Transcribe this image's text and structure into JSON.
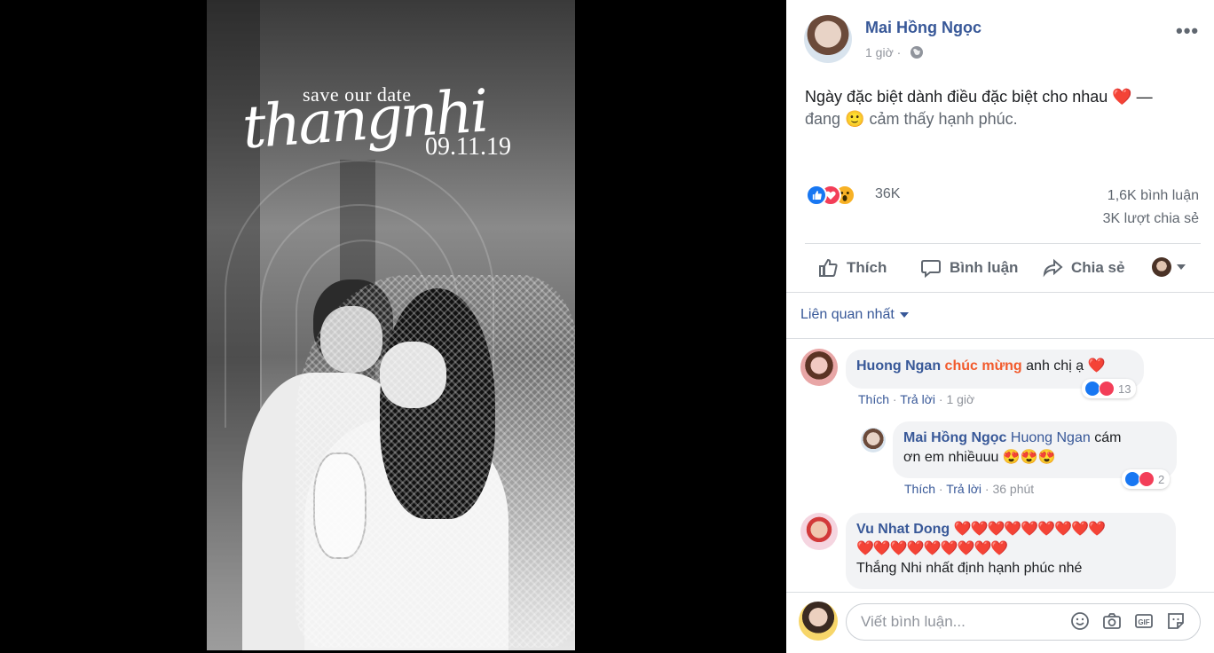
{
  "post": {
    "author": "Mai Hồng Ngọc",
    "time": "1 giờ",
    "separator": " · ",
    "more_label": "•••",
    "status_text": "Ngày đặc biệt dành điều đặc biệt cho nhau ❤️ —",
    "feeling_prefix": "đang",
    "feeling_emoji": "🙂",
    "feeling_text": "cảm thấy hạnh phúc.",
    "reactions_count": "36K",
    "comments_count": "1,6K bình luận",
    "shares_count": "3K lượt chia sẻ"
  },
  "photo": {
    "save_text": "save our date",
    "names": "thangnhi",
    "date": "09.11.19"
  },
  "actions": {
    "like": "Thích",
    "comment": "Bình luận",
    "share": "Chia sẻ"
  },
  "sort": {
    "label": "Liên quan nhất"
  },
  "comments": [
    {
      "author": "Huong Ngan",
      "highlight": "chúc mừng",
      "text": "anh chị ạ ❤️",
      "like": "Thích",
      "reply": "Trả lời",
      "time": "1 giờ",
      "reaction_count": "13"
    },
    {
      "author": "Mai Hồng Ngọc",
      "mention": "Huong Ngan",
      "text1": "cám",
      "text2": "ơn em nhiềuuu 😍😍😍",
      "like": "Thích",
      "reply": "Trả lời",
      "time": "36 phút",
      "reaction_count": "2"
    },
    {
      "author": "Vu Nhat Dong",
      "hearts1": "❤️❤️❤️❤️❤️❤️❤️❤️❤️",
      "hearts2": "❤️❤️❤️❤️❤️❤️❤️❤️❤️",
      "text": "Thắng Nhi nhất định hạnh phúc nhé"
    }
  ],
  "composer": {
    "placeholder": "Viết bình luận..."
  },
  "icons": [
    "globe-icon",
    "thumbs-up-icon",
    "comment-icon",
    "share-icon",
    "emoji-icon",
    "camera-icon",
    "gif-icon",
    "sticker-icon"
  ],
  "colors": {
    "link": "#385898",
    "highlight": "#f25a2c",
    "like_blue": "#1877f2",
    "love_red": "#f33e58"
  }
}
